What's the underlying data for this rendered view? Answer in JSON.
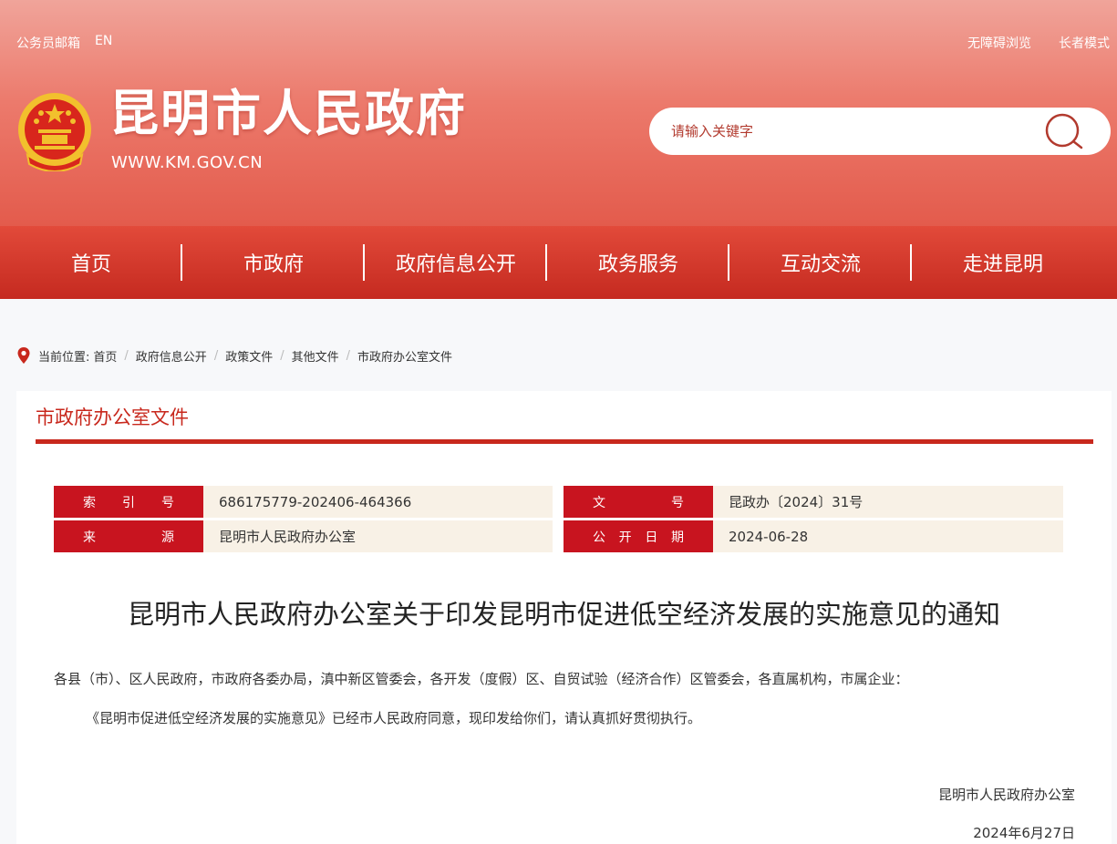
{
  "topbar": {
    "left": [
      "公务员邮箱",
      "EN"
    ],
    "right": [
      "无障碍浏览",
      "长者模式"
    ]
  },
  "site": {
    "title": "昆明市人民政府",
    "url": "WWW.KM.GOV.CN"
  },
  "search": {
    "placeholder": "请输入关键字"
  },
  "nav": [
    "首页",
    "市政府",
    "政府信息公开",
    "政务服务",
    "互动交流",
    "走进昆明"
  ],
  "breadcrumb": {
    "prefix": "当前位置:",
    "items": [
      "首页",
      "政府信息公开",
      "政策文件",
      "其他文件",
      "市政府办公室文件"
    ]
  },
  "section": {
    "title": "市政府办公室文件"
  },
  "meta": {
    "index_label": [
      "索",
      "引",
      "号"
    ],
    "index_value": "686175779-202406-464366",
    "docno_label": [
      "文",
      "号"
    ],
    "docno_value": "昆政办〔2024〕31号",
    "source_label": [
      "来",
      "源"
    ],
    "source_value": "昆明市人民政府办公室",
    "date_label": [
      "公",
      "开",
      "日",
      "期"
    ],
    "date_value": "2024-06-28"
  },
  "document": {
    "title": "昆明市人民政府办公室关于印发昆明市促进低空经济发展的实施意见的通知",
    "salutation": "各县（市）、区人民政府，市政府各委办局，滇中新区管委会，各开发（度假）区、自贸试验（经济合作）区管委会，各直属机构，市属企业：",
    "body": "《昆明市促进低空经济发展的实施意见》已经市人民政府同意，现印发给你们，请认真抓好贯彻执行。",
    "signature_org": "昆明市人民政府办公室",
    "signature_date": "2024年6月27日"
  },
  "colors": {
    "brand_red": "#c8281d",
    "label_red": "#c8141f",
    "value_bg": "#f8f1e6"
  }
}
